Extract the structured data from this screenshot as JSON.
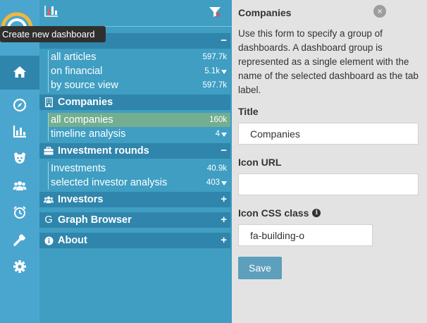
{
  "tooltip": "Create new dashboard",
  "sections": [
    {
      "label": "",
      "icon": "none",
      "toggle": "−",
      "rows": [
        {
          "label": "all articles",
          "count": "597.7k",
          "filtered": false,
          "selected": false
        },
        {
          "label": "on financial",
          "count": "5.1k",
          "filtered": true,
          "selected": false
        },
        {
          "label": "by source view",
          "count": "597.7k",
          "filtered": false,
          "selected": false
        }
      ]
    },
    {
      "label": "Companies",
      "icon": "building-icon",
      "toggle": "",
      "rows": [
        {
          "label": "all companies",
          "count": "160k",
          "filtered": false,
          "selected": true
        },
        {
          "label": "timeline analysis",
          "count": "4",
          "filtered": true,
          "selected": false
        }
      ]
    },
    {
      "label": "Investment rounds",
      "icon": "briefcase-icon",
      "toggle": "−",
      "rows": [
        {
          "label": "Investments",
          "count": "40.9k",
          "filtered": false,
          "selected": false
        },
        {
          "label": "selected investor analysis",
          "count": "403",
          "filtered": true,
          "selected": false
        }
      ]
    },
    {
      "label": "Investors",
      "icon": "users-icon",
      "toggle": "+"
    },
    {
      "label": "Graph Browser",
      "icon": "G",
      "toggle": "+"
    },
    {
      "label": "About",
      "icon": "info-icon",
      "toggle": "+"
    }
  ],
  "form": {
    "title": "Companies",
    "close": "×",
    "description": "Use this form to specify a group of dashboards. A dashboard group is represented as a single element with the name of the selected dashboard as the tab label.",
    "title_label": "Title",
    "title_value": "Companies",
    "icon_url_label": "Icon URL",
    "icon_url_value": "",
    "icon_css_label": "Icon CSS class",
    "icon_css_value": "fa-building-o",
    "save_label": "Save",
    "info_glyph": "i"
  },
  "colors": {
    "rail": "#4aa6cf",
    "panel": "#3f9ec2",
    "section_header": "#2f85ab",
    "selected_row": "#74ae91",
    "form_bg": "#e3e3e3",
    "save_button": "#5d9fbd"
  }
}
